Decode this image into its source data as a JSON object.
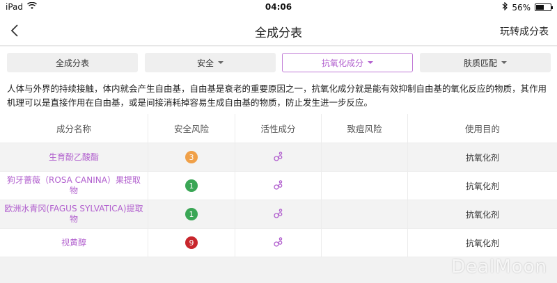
{
  "status_bar": {
    "device": "iPad",
    "time": "04:06",
    "battery": "56%",
    "battery_level": 0.56
  },
  "nav": {
    "title": "全成分表",
    "right_action": "玩转成分表"
  },
  "filters": [
    {
      "label": "全成分表",
      "has_caret": false,
      "active": false
    },
    {
      "label": "安全",
      "has_caret": true,
      "active": false
    },
    {
      "label": "抗氧化成分",
      "has_caret": true,
      "active": true
    },
    {
      "label": "肤质匹配",
      "has_caret": true,
      "active": false
    }
  ],
  "description": "人体与外界的持续接触，体内就会产生自由基，自由基是衰老的重要原因之一，抗氧化成分就是能有效抑制自由基的氧化反应的物质，其作用机理可以是直接作用在自由基，或是间接消耗掉容易生成自由基的物质，防止发生进一步反应。",
  "table": {
    "headers": [
      "成分名称",
      "安全风险",
      "活性成分",
      "致痘风险",
      "使用目的"
    ],
    "rows": [
      {
        "name": "生育酚乙酸酯",
        "risk": "3",
        "risk_color": "#f0a048",
        "purpose": "抗氧化剂"
      },
      {
        "name": "狗牙蔷薇（ROSA CANINA）果提取物",
        "risk": "1",
        "risk_color": "#3aa655",
        "purpose": "抗氧化剂"
      },
      {
        "name": "欧洲水青冈(FAGUS SYLVATICA)提取物",
        "risk": "1",
        "risk_color": "#3aa655",
        "purpose": "抗氧化剂"
      },
      {
        "name": "视黄醇",
        "risk": "9",
        "risk_color": "#c8262c",
        "purpose": "抗氧化剂"
      }
    ]
  },
  "colors": {
    "accent": "#b15fce"
  },
  "watermark": "DealMoon"
}
